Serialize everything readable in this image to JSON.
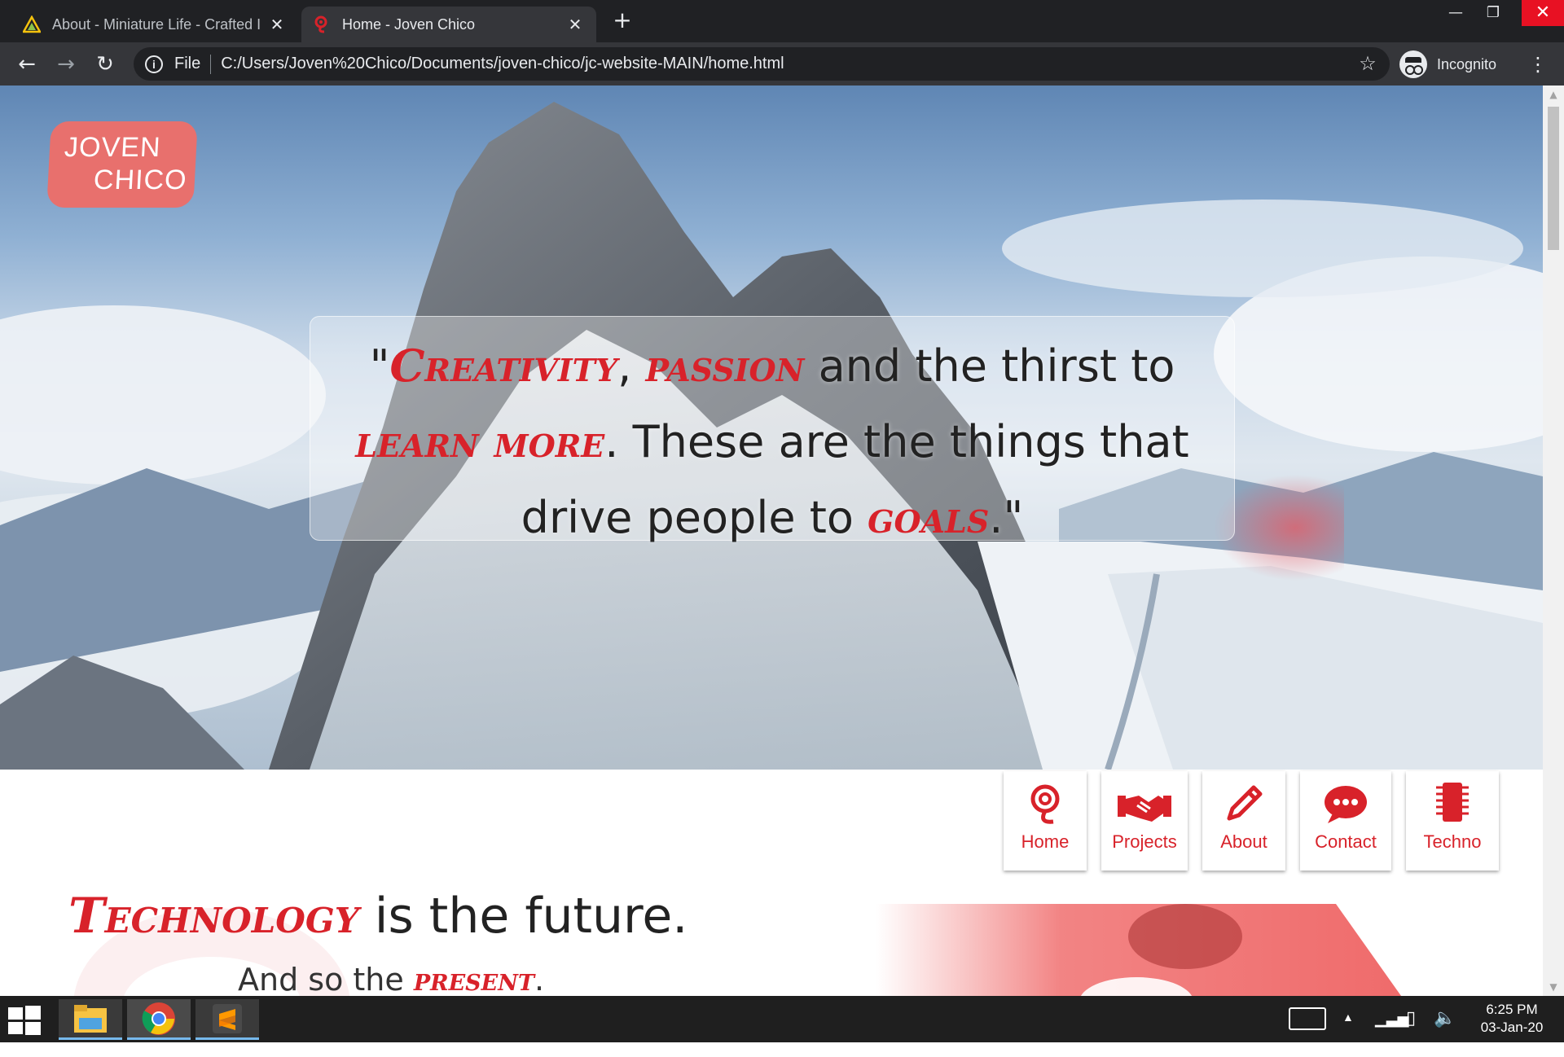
{
  "browser": {
    "tabs": [
      {
        "title": "About - Miniature Life - Crafted I",
        "favicon": "triangle-logo-icon",
        "active": false
      },
      {
        "title": "Home - Joven Chico",
        "favicon": "jc-logo-icon",
        "active": true
      }
    ],
    "close_glyph": "✕",
    "new_tab_glyph": "+",
    "window_controls": {
      "minimize": "—",
      "maximize": "❐",
      "close": "✕"
    },
    "omnibox": {
      "scheme": "File",
      "url": "C:/Users/Joven%20Chico/Documents/joven-chico/jc-website-MAIN/home.html"
    },
    "incognito_label": "Incognito",
    "nav": {
      "back": "←",
      "forward": "→",
      "reload": "↻",
      "star": "☆",
      "menu": "⋮"
    }
  },
  "site": {
    "logo": {
      "line1": "JOVEN",
      "line2": "CHICO"
    },
    "quote": {
      "open": "\"",
      "w1": "Creativity",
      "comma": ", ",
      "w2": "passion",
      "t1": " and the thirst to ",
      "w3": "learn more",
      "t2": ". These are the things that drive people to ",
      "w4": "goals",
      "close": ".\""
    },
    "nav_tiles": [
      {
        "label": "Home",
        "icon": "home-target-icon"
      },
      {
        "label": "Projects",
        "icon": "handshake-icon"
      },
      {
        "label": "About",
        "icon": "pencil-icon"
      },
      {
        "label": "Contact",
        "icon": "chat-bubble-icon"
      },
      {
        "label": "Techno",
        "icon": "chip-icon"
      }
    ],
    "tech": {
      "accent": "Technology",
      "rest": " is the future.",
      "sub_prefix": "And so the ",
      "sub_accent": "present",
      "sub_suffix": "."
    }
  },
  "taskbar": {
    "apps": [
      "file-explorer-icon",
      "chrome-icon",
      "sublime-text-icon"
    ],
    "time": "6:25 PM",
    "date": "03-Jan-20"
  },
  "colors": {
    "accent": "#d8222a",
    "logo_bg": "#e8706d",
    "chrome_dark": "#202124",
    "chrome_toolbar": "#35363a",
    "taskbar": "#1f1f1f"
  }
}
